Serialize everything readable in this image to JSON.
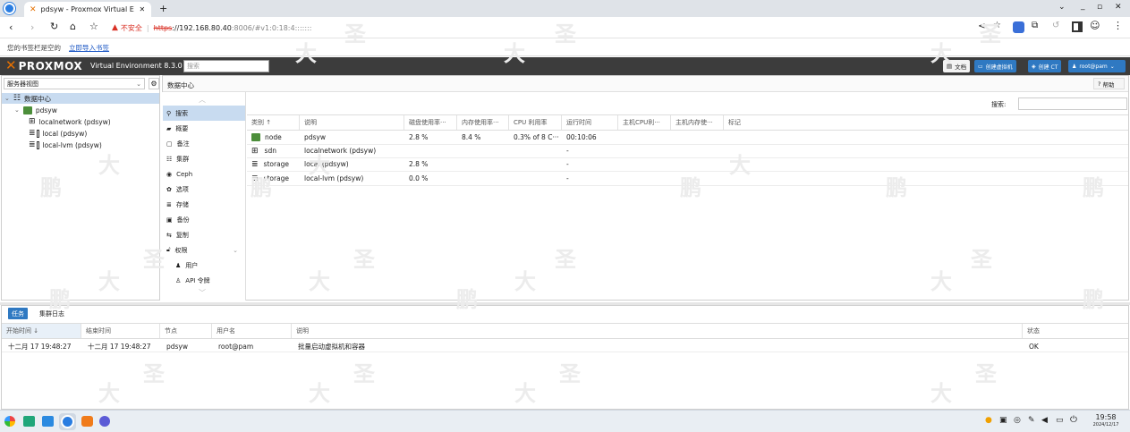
{
  "browser": {
    "tab_title": "pdsyw - Proxmox Virtual E",
    "insecure_label": "不安全",
    "url_scheme": "https",
    "url_host": "://192.168.80.40",
    "url_rest": ":8006/#v1:0:18:4:::::::",
    "bookmark_empty_text": "您的书签栏是空的",
    "bookmark_import_link": "立即导入书签"
  },
  "pve": {
    "logo_text": "PROXMOX",
    "product_name": "Virtual Environment 8.3.0",
    "search_placeholder": "搜索",
    "docs_label": "文档",
    "create_vm_label": "创建虚拟机",
    "create_ct_label": "创建 CT",
    "user_label": "root@pam",
    "help_label": "帮助",
    "accent": "#2f79c2"
  },
  "tree": {
    "view_label": "服务器视图",
    "items": [
      {
        "label": "数据中心",
        "icon": "datacenter-icon"
      },
      {
        "label": "pdsyw",
        "icon": "node-icon"
      },
      {
        "label": "localnetwork (pdsyw)",
        "icon": "sdn-icon"
      },
      {
        "label": "local (pdsyw)",
        "icon": "storage-icon"
      },
      {
        "label": "local-lvm (pdsyw)",
        "icon": "storage-icon"
      }
    ]
  },
  "content": {
    "title": "数据中心",
    "search_label": "搜索:",
    "nav": [
      {
        "label": "搜索",
        "icon": "search-icon"
      },
      {
        "label": "概要",
        "icon": "summary-icon"
      },
      {
        "label": "备注",
        "icon": "notes-icon"
      },
      {
        "label": "集群",
        "icon": "cluster-icon"
      },
      {
        "label": "Ceph",
        "icon": "ceph-icon"
      },
      {
        "label": "选项",
        "icon": "gear-icon"
      },
      {
        "label": "存储",
        "icon": "storage-icon"
      },
      {
        "label": "备份",
        "icon": "backup-icon"
      },
      {
        "label": "复制",
        "icon": "replication-icon"
      },
      {
        "label": "权限",
        "icon": "unlock-icon"
      },
      {
        "label": "用户",
        "icon": "user-icon"
      },
      {
        "label": "API 令牌",
        "icon": "user-outline-icon"
      }
    ],
    "columns": [
      "类别 ↑",
      "说明",
      "磁盘使用率···",
      "内存使用率···",
      "CPU 利用率",
      "运行时间",
      "主机CPU利···",
      "主机内存使···",
      "标记"
    ],
    "rows": [
      {
        "type": "node",
        "desc": "pdsyw",
        "disk": "2.8 %",
        "mem": "8.4 %",
        "cpu": "0.3% of 8 C···",
        "uptime": "00:10:06"
      },
      {
        "type": "sdn",
        "desc": "localnetwork (pdsyw)",
        "disk": "",
        "mem": "",
        "cpu": "",
        "uptime": "-"
      },
      {
        "type": "storage",
        "desc": "local (pdsyw)",
        "disk": "2.8 %",
        "mem": "",
        "cpu": "",
        "uptime": "-"
      },
      {
        "type": "storage",
        "desc": "local-lvm (pdsyw)",
        "disk": "0.0 %",
        "mem": "",
        "cpu": "",
        "uptime": "-"
      }
    ]
  },
  "tasks": {
    "tab_tasks": "任务",
    "tab_cluster_log": "集群日志",
    "columns": [
      "开始时间 ↓",
      "结束时间",
      "节点",
      "用户名",
      "说明",
      "状态"
    ],
    "rows": [
      {
        "start": "十二月 17 19:48:27",
        "end": "十二月 17 19:48:27",
        "node": "pdsyw",
        "user": "root@pam",
        "desc": "批量启动虚拟机和容器",
        "status": "OK"
      }
    ]
  },
  "taskbar": {
    "time": "19:58",
    "date": "2024/12/17"
  },
  "watermark": [
    "鹏",
    "大",
    "圣"
  ]
}
